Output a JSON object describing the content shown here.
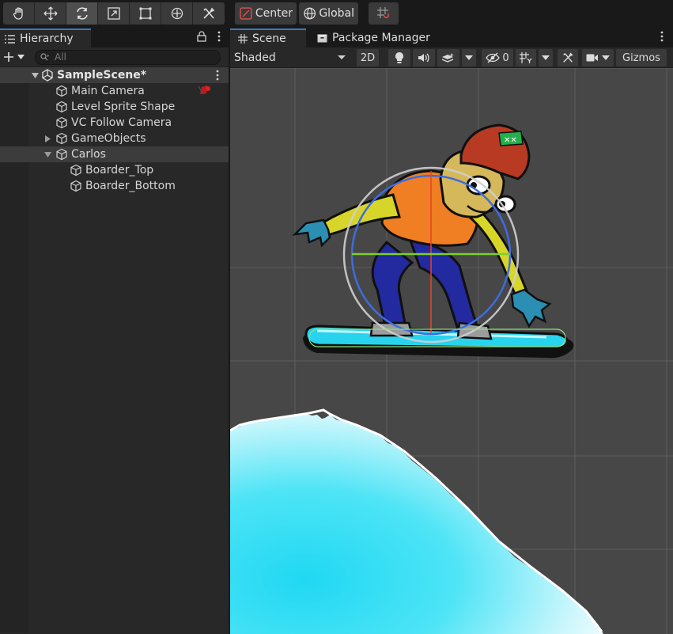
{
  "toolbar": {
    "tools": [
      {
        "name": "hand-tool",
        "icon": "hand-icon"
      },
      {
        "name": "move-tool",
        "icon": "move-arrows-icon"
      },
      {
        "name": "rotate-tool",
        "icon": "rotate-icon",
        "active": true
      },
      {
        "name": "scale-tool",
        "icon": "scale-icon"
      },
      {
        "name": "rect-tool",
        "icon": "rect-transform-icon"
      },
      {
        "name": "transform-tool",
        "icon": "transform-icon"
      },
      {
        "name": "custom-tool",
        "icon": "tools-icon"
      }
    ],
    "pivot_label": "Center",
    "space_label": "Global",
    "grid_snap_icon": "grid-snap-icon"
  },
  "hierarchy": {
    "tab_label": "Hierarchy",
    "search_placeholder": "All",
    "scene_name": "SampleScene*",
    "items": [
      {
        "label": "Main Camera",
        "depth": 1
      },
      {
        "label": "Level Sprite Shape",
        "depth": 1
      },
      {
        "label": "VC Follow Camera",
        "depth": 1
      },
      {
        "label": "GameObjects",
        "depth": 1,
        "collapsed": true
      },
      {
        "label": "Carlos",
        "depth": 1,
        "expanded": true
      },
      {
        "label": "Boarder_Top",
        "depth": 2
      },
      {
        "label": "Boarder_Bottom",
        "depth": 2
      }
    ]
  },
  "scene": {
    "tabs": [
      {
        "label": "Scene",
        "active": true
      },
      {
        "label": "Package Manager"
      }
    ],
    "shading_mode": "Shaded",
    "mode_2d_label": "2D",
    "hidden_count": "0",
    "gizmos_label": "Gizmos"
  },
  "colors": {
    "accent": "#3a79bb",
    "scene_bg": "#474747",
    "panel_bg": "#282828",
    "snow": "#2ad6f0"
  }
}
